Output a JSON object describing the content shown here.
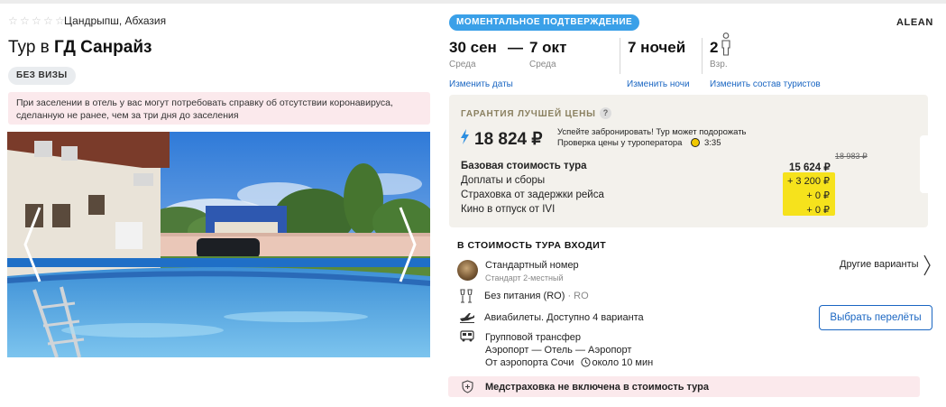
{
  "hotel": {
    "stars_filled": 0,
    "stars_total": 5,
    "location": "Цандрыпш, Абхазия",
    "title_prefix": "Тур в",
    "title_name": "ГД Санрайз",
    "visa_badge": "БЕЗ ВИЗЫ",
    "notice": "При заселении в отель у вас могут потребовать справку об отсутствии коронавируса, сделанную не ранее, чем за три дня до заселения"
  },
  "booking": {
    "instant_badge": "МОМЕНТАЛЬНОЕ ПОДТВЕРЖДЕНИЕ",
    "operator": "ALEAN",
    "date_from": "30 сен",
    "date_from_day": "Среда",
    "dash": "—",
    "date_to": "7 окт",
    "date_to_day": "Среда",
    "nights": "7 ночей",
    "adults": "2",
    "adults_label": "Взр.",
    "link_change_dates": "Изменить даты",
    "link_change_nights": "Изменить ночи",
    "link_change_tourists": "Изменить состав туристов"
  },
  "price": {
    "guarantee": "ГАРАНТИЯ ЛУЧШЕЙ ЦЕНЫ",
    "help": "?",
    "total": "18 824 ₽",
    "hint_line1": "Успейте забронировать! Тур может подорожать",
    "hint_line2": "Проверка цены у туроператора",
    "timer": "3:35",
    "old_price": "18 983 ₽",
    "base_label": "Базовая стоимость тура",
    "base_value": "15 624 ₽",
    "rows": [
      {
        "label": "Доплаты и сборы",
        "value": "+ 3 200 ₽"
      },
      {
        "label": "Страховка от задержки рейса",
        "value": "+ 0 ₽"
      },
      {
        "label": "Кино в отпуск от IVI",
        "value": "+ 0 ₽"
      }
    ]
  },
  "included": {
    "heading": "В СТОИМОСТЬ ТУРА ВХОДИТ",
    "room_name": "Стандартный номер",
    "room_sub": "Стандарт 2-местный",
    "other_variants": "Другие варианты",
    "meal": "Без питания (RO)",
    "meal_code": "· RO",
    "flights": "Авиабилеты. Доступно 4 варианта",
    "choose_flights": "Выбрать перелёты",
    "transfer_type": "Групповой трансфер",
    "transfer_route": "Аэропорт — Отель — Аэропорт",
    "transfer_from": "От аэропорта Сочи",
    "transfer_time": "около 10 мин",
    "insurance": "Медстраховка не включена в стоимость тура"
  },
  "colors": {
    "accent_blue": "#1a66c2",
    "badge_blue": "#3aa0e8",
    "highlight_yellow": "#f6e21c",
    "notice_pink": "#fbe9ec"
  }
}
